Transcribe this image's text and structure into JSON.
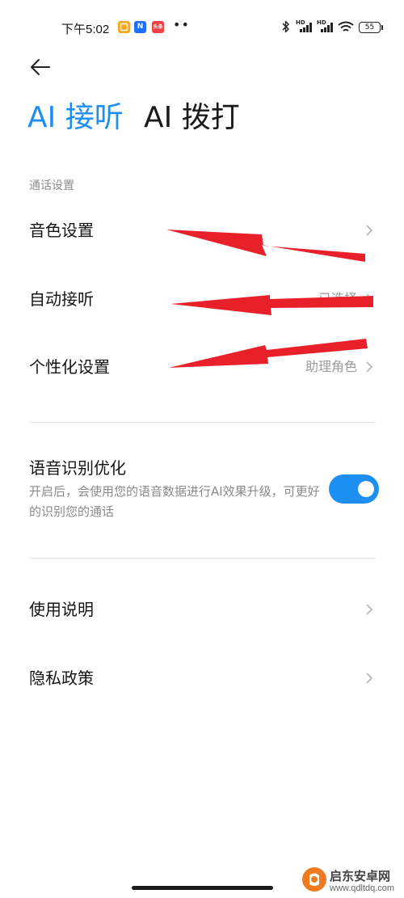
{
  "status_bar": {
    "time": "下午5:02",
    "app_icons": [
      {
        "name": "notes-app-icon",
        "color": "#f5a623"
      },
      {
        "name": "n-app-icon",
        "color": "#1e6fff",
        "label": "N"
      },
      {
        "name": "toutiao-app-icon",
        "color": "#f04142",
        "label": "头条"
      }
    ],
    "more_dots": "••",
    "signal_labels": [
      "HD",
      "HD"
    ],
    "battery": "55"
  },
  "header": {
    "back_icon": "arrow-left-icon",
    "tabs": [
      {
        "label": "AI 接听",
        "active": true
      },
      {
        "label": "AI 拨打",
        "active": false
      }
    ]
  },
  "call_settings": {
    "section_title": "通话设置",
    "items": [
      {
        "label": "音色设置",
        "value": ""
      },
      {
        "label": "自动接听",
        "value": "已选择"
      },
      {
        "label": "个性化设置",
        "value": "助理角色"
      }
    ]
  },
  "speech_optimization": {
    "title": "语音识别优化",
    "description": "开启后，会使用您的语音数据进行AI效果升级，可更好的识别您的通话",
    "enabled": true
  },
  "other_items": [
    {
      "label": "使用说明"
    },
    {
      "label": "隐私政策"
    }
  ],
  "annotations": {
    "arrow_color": "#e8202a",
    "count": 3
  },
  "watermark": {
    "name": "启东安卓网",
    "url": "www.qdltdq.com"
  },
  "colors": {
    "accent": "#1d8ef2",
    "text_primary": "#141414",
    "text_secondary": "#8c8c8c"
  }
}
